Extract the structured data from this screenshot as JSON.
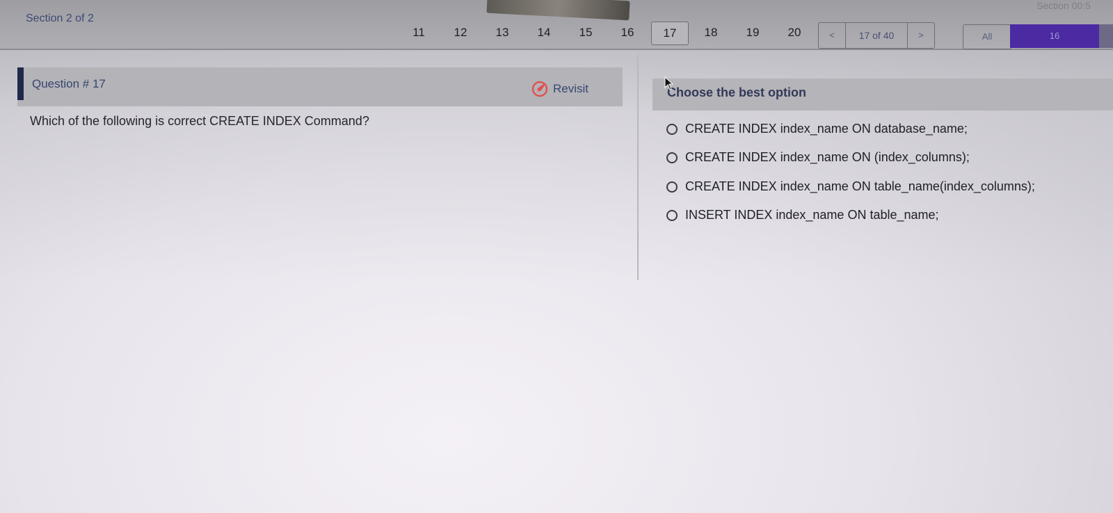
{
  "header": {
    "section_label": "Section 2 of 2",
    "section_timer": "Section 00:5"
  },
  "question_nav": {
    "numbers": [
      "11",
      "12",
      "13",
      "14",
      "15",
      "16",
      "17",
      "18",
      "19",
      "20"
    ],
    "current": "17",
    "prev_label": "<",
    "next_label": ">",
    "position_text": "17 of 40"
  },
  "filter": {
    "all_label": "All",
    "count_label": "16",
    "accent_color": "#4c2aa2"
  },
  "question": {
    "number_label": "Question # 17",
    "revisit_label": "Revisit",
    "text": "Which of the following is correct CREATE INDEX Command?"
  },
  "options": {
    "title": "Choose the best option",
    "items": [
      "CREATE INDEX index_name ON database_name;",
      "CREATE INDEX index_name ON (index_columns);",
      "CREATE INDEX index_name ON table_name(index_columns);",
      "INSERT INDEX index_name ON table_name;"
    ]
  },
  "icons": {
    "revisit": "pencil-circle-icon",
    "cursor": "mouse-cursor-icon"
  }
}
